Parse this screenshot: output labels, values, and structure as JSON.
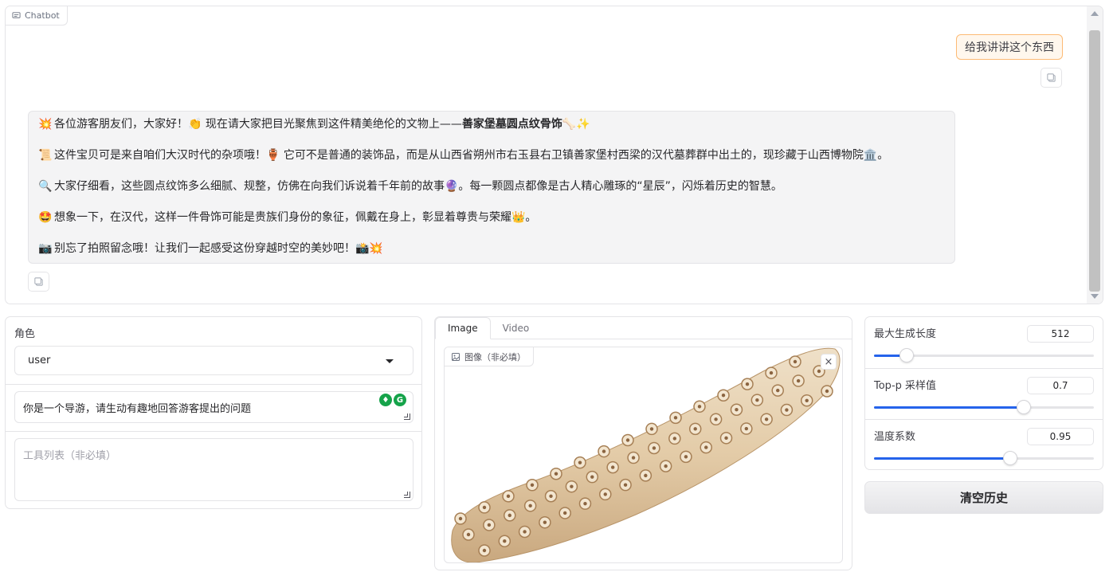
{
  "chatbot": {
    "label": "Chatbot",
    "user_message": "给我讲讲这个东西",
    "bot_lines": [
      {
        "emoji": "💥",
        "pre": "各位游客朋友们，大家好！👏 现在请大家把目光聚焦到这件精美绝伦的文物上——",
        "bold": "善家堡墓圆点纹骨饰",
        "post": "🦴✨"
      },
      {
        "emoji": "📜",
        "pre": "这件宝贝可是来自咱们大汉时代的杂项哦！🏺 它可不是普通的装饰品，而是从山西省朔州市右玉县右卫镇善家堡村西梁的汉代墓葬群中出土的，现珍藏于山西博物院🏛️。",
        "bold": "",
        "post": ""
      },
      {
        "emoji": "🔍",
        "pre": "大家仔细看，这些圆点纹饰多么细腻、规整，仿佛在向我们诉说着千年前的故事🔮。每一颗圆点都像是古人精心雕琢的“星辰”，闪烁着历史的智慧。",
        "bold": "",
        "post": ""
      },
      {
        "emoji": "🤩",
        "pre": "想象一下，在汉代，这样一件骨饰可能是贵族们身份的象征，佩戴在身上，彰显着尊贵与荣耀👑。",
        "bold": "",
        "post": ""
      },
      {
        "emoji": "📷",
        "pre": "别忘了拍照留念哦！让我们一起感受这份穿越时空的美妙吧！📸💥",
        "bold": "",
        "post": ""
      }
    ]
  },
  "left": {
    "role_label": "角色",
    "role_value": "user",
    "system_prompt": "你是一个导游，请生动有趣地回答游客提出的问题",
    "tools_placeholder": "工具列表（非必填）"
  },
  "media": {
    "tabs": [
      "Image",
      "Video"
    ],
    "active_tab": "Image",
    "image_label": "图像（非必填）",
    "close_symbol": "×"
  },
  "params": {
    "max_len": {
      "label": "最大生成长度",
      "value": "512",
      "fraction": 0.15
    },
    "top_p": {
      "label": "Top-p 采样值",
      "value": "0.7",
      "fraction": 0.68
    },
    "temperature": {
      "label": "温度系数",
      "value": "0.95",
      "fraction": 0.62
    }
  },
  "clear_button": "清空历史",
  "colors": {
    "accent": "#2563eb",
    "user_bubble": "#fff7ed",
    "user_border": "#fdba74",
    "bot_bubble": "#f4f4f5"
  }
}
